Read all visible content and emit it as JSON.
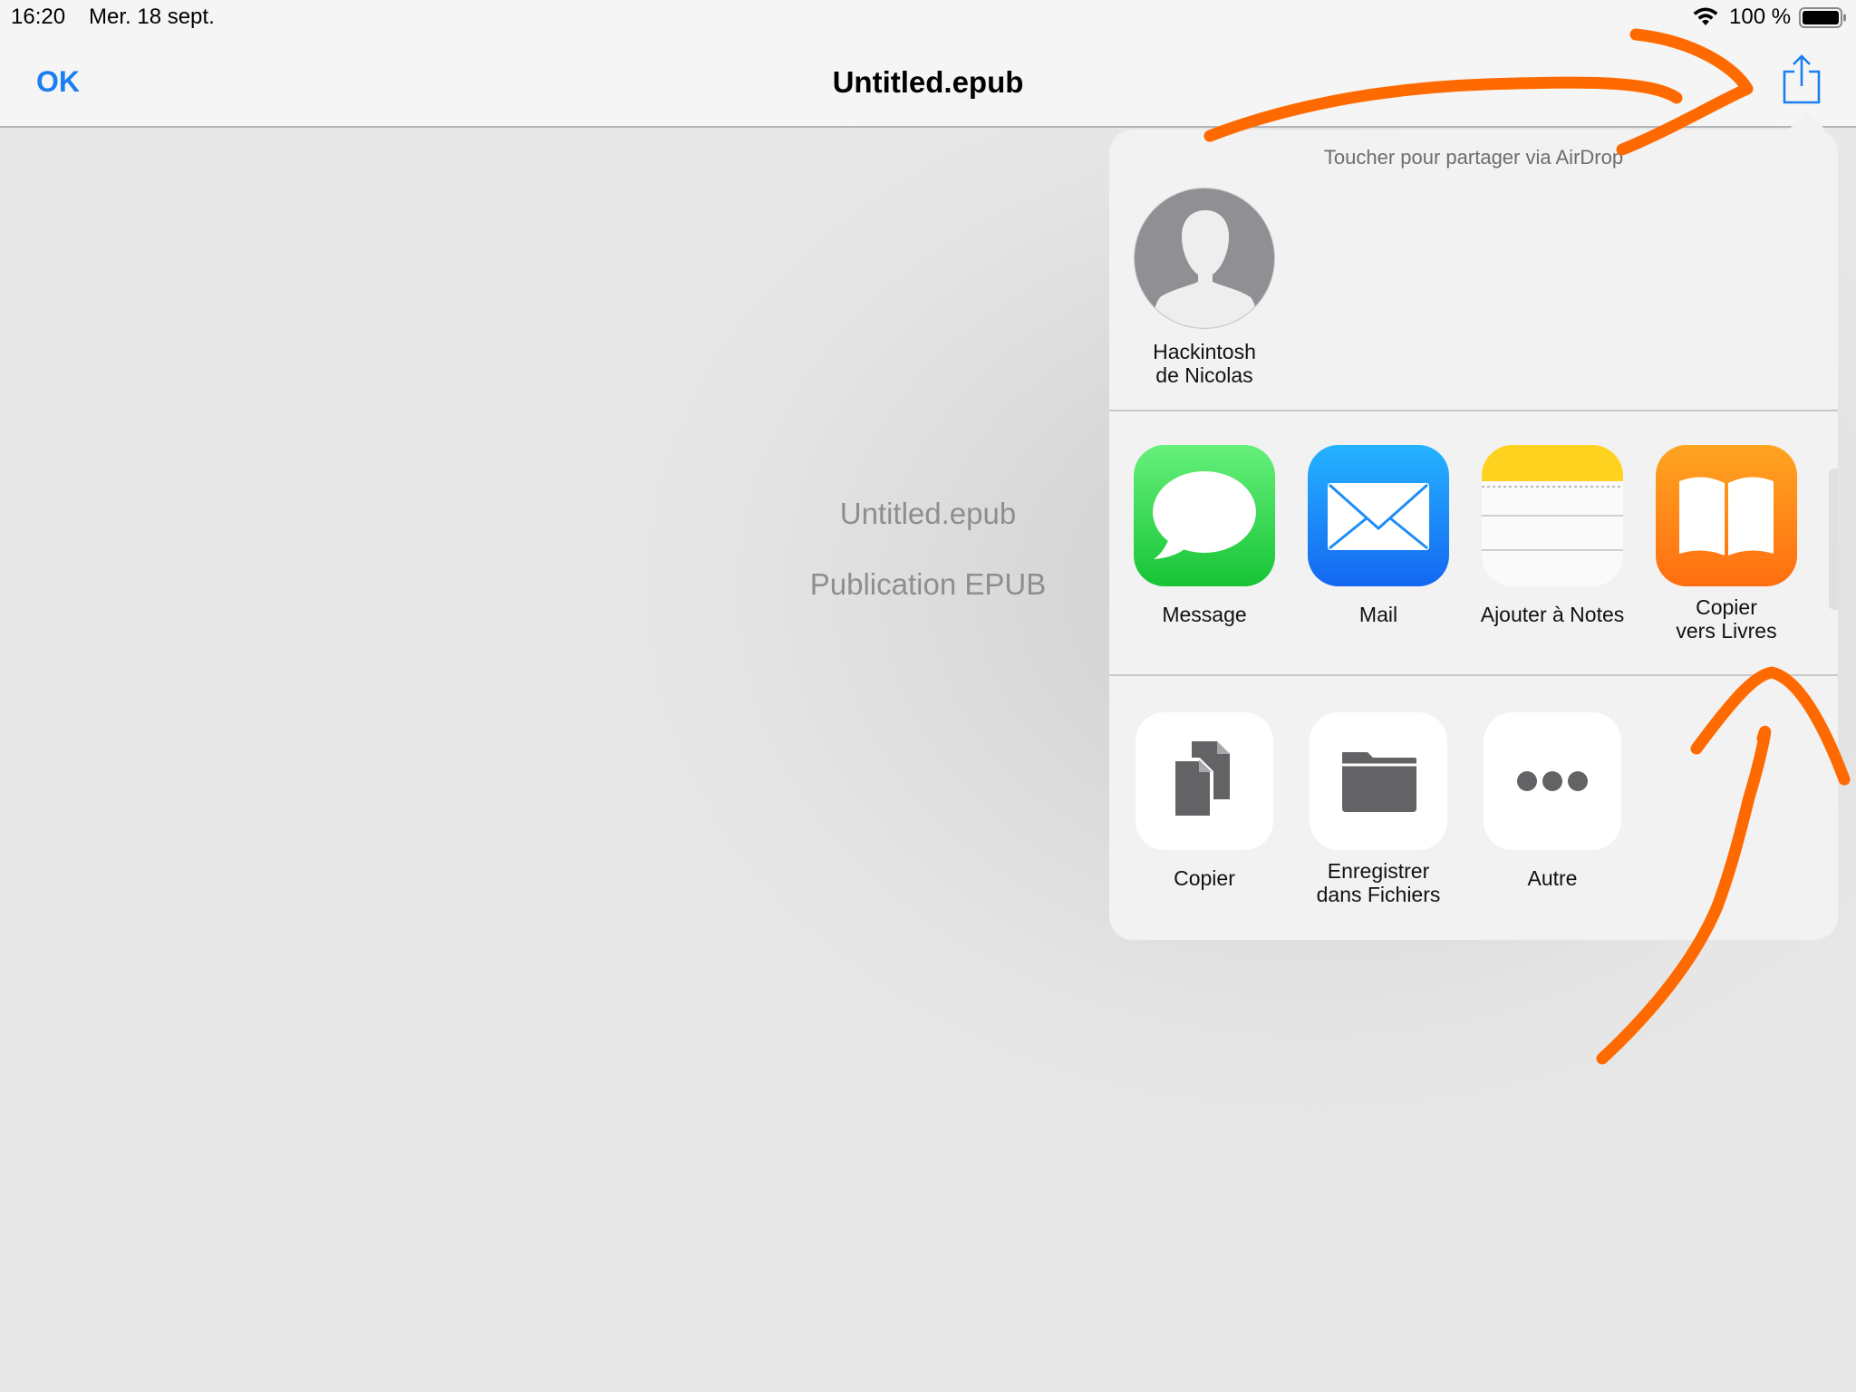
{
  "status_bar": {
    "time": "16:20",
    "date": "Mer. 18 sept.",
    "battery": "100 %"
  },
  "nav": {
    "ok_label": "OK",
    "title": "Untitled.epub"
  },
  "document": {
    "name": "Untitled.epub",
    "kind": "Publication EPUB"
  },
  "share_sheet": {
    "airdrop_hint": "Toucher pour partager via AirDrop",
    "airdrop_devices": [
      {
        "label": "Hackintosh\nde Nicolas",
        "icon": "person-silhouette"
      }
    ],
    "apps": [
      {
        "label": "Message",
        "icon": "messages-icon"
      },
      {
        "label": "Mail",
        "icon": "mail-icon"
      },
      {
        "label": "Ajouter à Notes",
        "icon": "notes-icon"
      },
      {
        "label": "Copier\nvers Livres",
        "icon": "books-icon"
      }
    ],
    "actions": [
      {
        "label": "Copier",
        "icon": "copy-icon"
      },
      {
        "label": "Enregistrer\ndans Fichiers",
        "icon": "folder-icon"
      },
      {
        "label": "Autre",
        "icon": "more-icon"
      }
    ]
  },
  "colors": {
    "accent": "#1a7ff0",
    "annotation": "#ff6a00"
  }
}
